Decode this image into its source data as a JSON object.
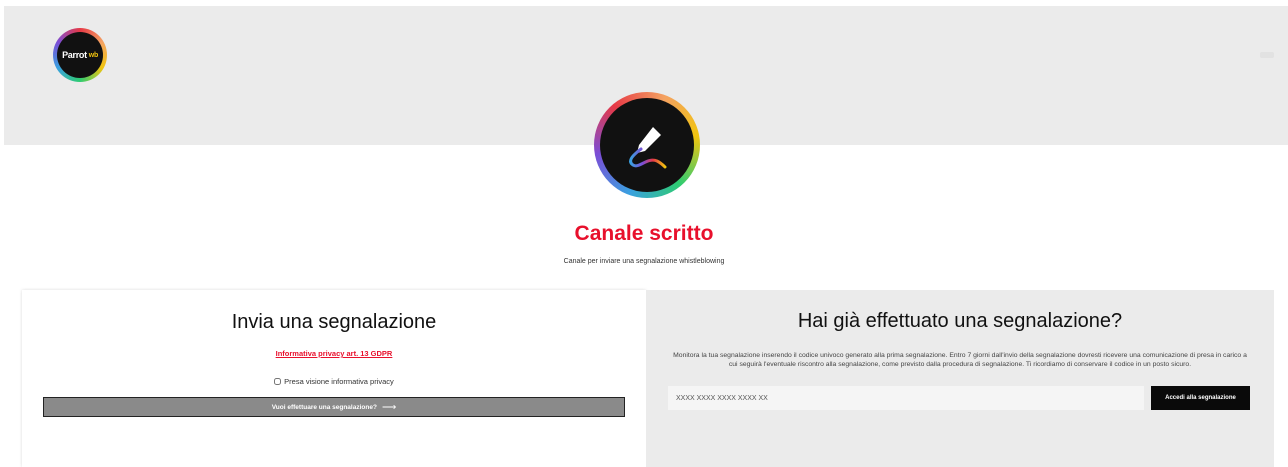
{
  "header": {
    "logo_text": "Parrot",
    "logo_accent": "wb",
    "menu_icon": "menu-icon"
  },
  "hero": {
    "badge_icon": "pen-icon",
    "title": "Canale scritto",
    "subtitle": "Canale per inviare una segnalazione whistleblowing"
  },
  "send_card": {
    "title": "Invia una segnalazione",
    "privacy_link": "Informativa privacy art. 13 GDPR",
    "consent_label": "Presa visione informativa privacy",
    "consent_checked": false,
    "button_label": "Vuoi effettuare una segnalazione?",
    "button_icon": "arrow-right-icon"
  },
  "access_card": {
    "title": "Hai già effettuato una segnalazione?",
    "description": "Monitora la tua segnalazione inserendo il codice univoco generato alla prima segnalazione. Entro 7 giorni dall'invio della segnalazione dovresti ricevere una comunicazione di presa in carico a cui seguirà l'eventuale riscontro alla segnalazione, come previsto dalla procedura di segnalazione. Ti ricordiamo di conservare il codice in un posto sicuro.",
    "code_placeholder": "XXXX XXXX XXXX XXXX XX",
    "button_label": "Accedi alla segnalazione"
  },
  "colors": {
    "accent": "#e8102c",
    "hero_bg": "#ebebeb",
    "button_dark": "#0a0a0a",
    "button_grey": "#8a8a8a"
  }
}
